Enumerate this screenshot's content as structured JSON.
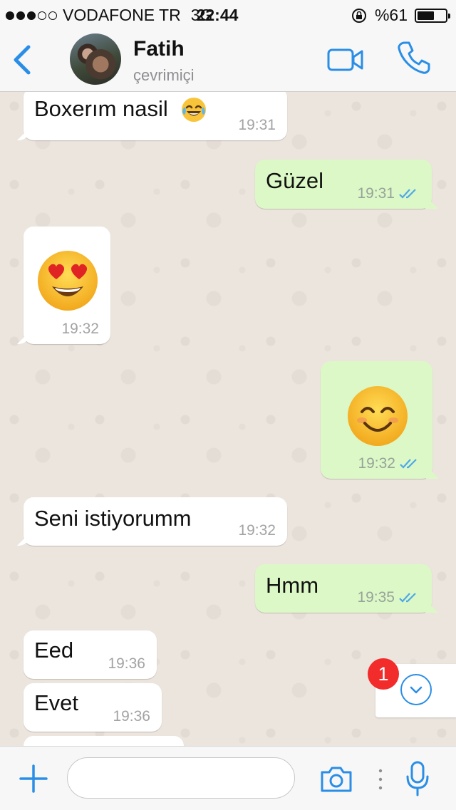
{
  "status_bar": {
    "signal_dots_full": 3,
    "signal_dots_total": 5,
    "carrier": "VODAFONE TR",
    "network": "3G",
    "time": "22:44",
    "battery": "%61",
    "battery_level": 0.61
  },
  "header": {
    "contact_name": "Fatih",
    "contact_status": "çevrimiçi",
    "accent_color": "#2a8ee6"
  },
  "messages": [
    {
      "direction": "in",
      "text": "Boxerım nasil",
      "emoji": "tears-of-joy",
      "time": "19:31"
    },
    {
      "direction": "out",
      "text": "Güzel",
      "time": "19:31",
      "read": true
    },
    {
      "direction": "in",
      "text": "",
      "emoji": "heart-eyes",
      "time": "19:32"
    },
    {
      "direction": "out",
      "text": "",
      "emoji": "smiling-eyes",
      "time": "19:32",
      "read": true
    },
    {
      "direction": "in",
      "text": "Seni istiyorumm",
      "time": "19:32"
    },
    {
      "direction": "out",
      "text": "Hmm",
      "time": "19:35",
      "read": true
    },
    {
      "direction": "in",
      "text": "Eed",
      "time": "19:36"
    },
    {
      "direction": "in",
      "text": "Evet",
      "time": "19:36"
    }
  ],
  "scroll_down": {
    "unread_count": "1"
  },
  "input_bar": {
    "message_value": ""
  }
}
